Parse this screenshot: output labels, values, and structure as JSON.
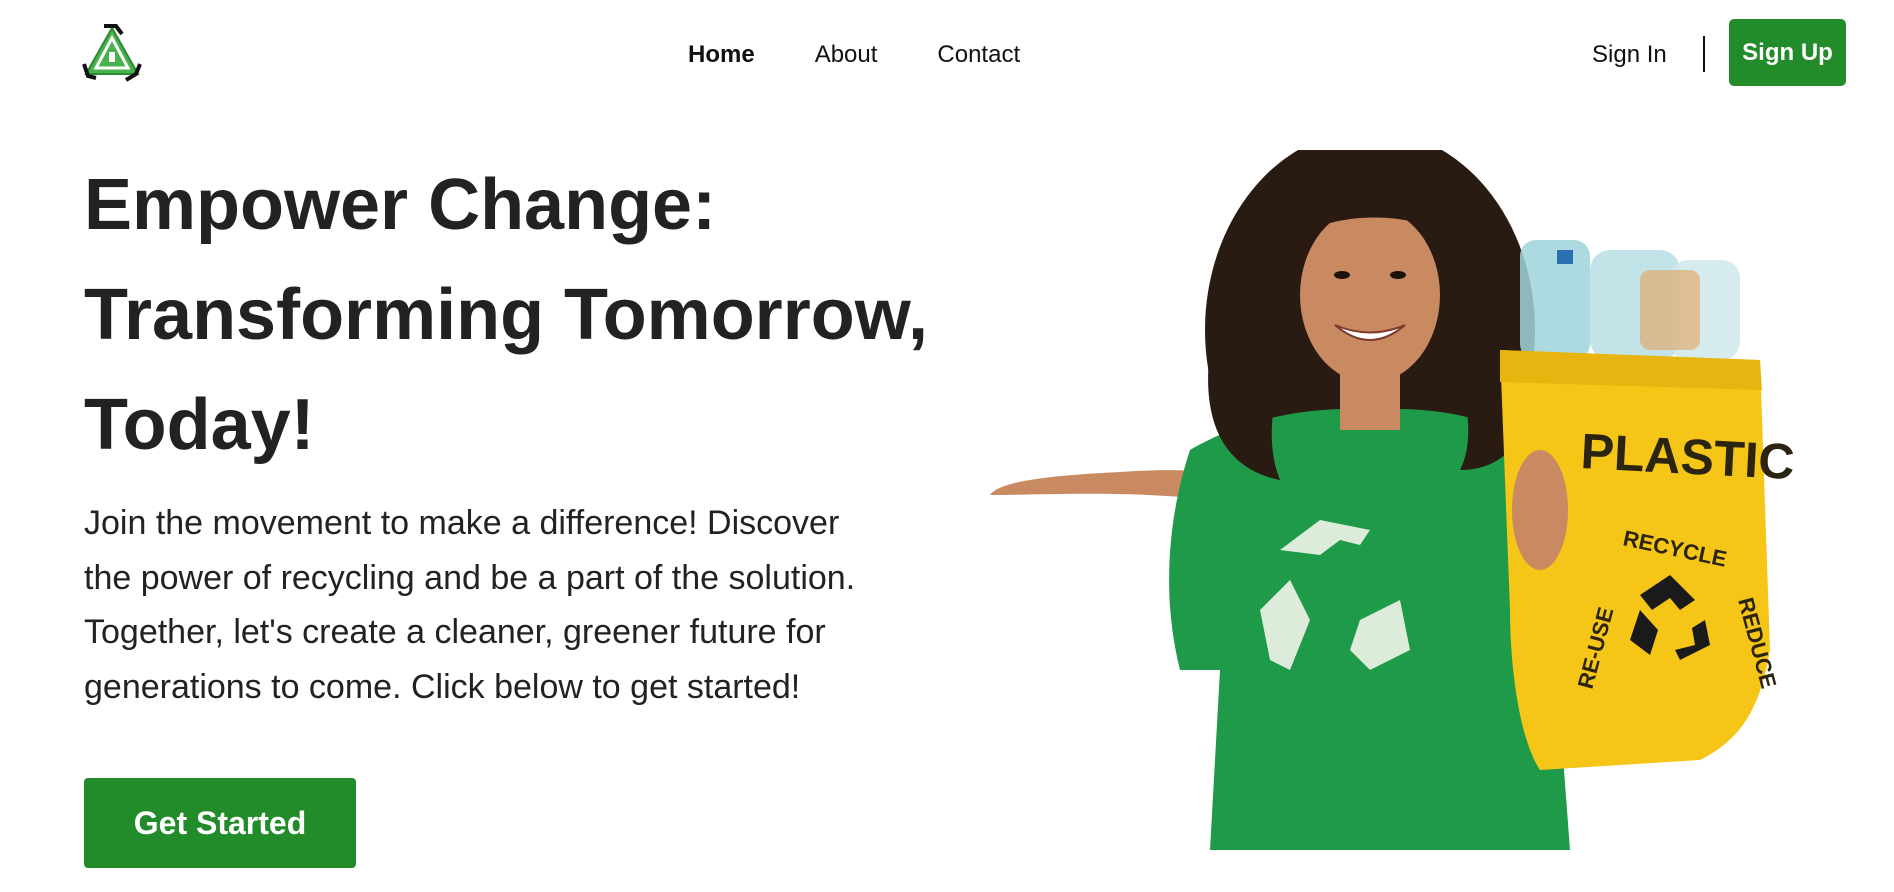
{
  "brand": {
    "logo_icon": "recycle-logo-icon",
    "accent_color": "#238c2a"
  },
  "nav": {
    "links": [
      {
        "label": "Home",
        "active": true
      },
      {
        "label": "About",
        "active": false
      },
      {
        "label": "Contact",
        "active": false
      }
    ],
    "sign_in_label": "Sign In",
    "sign_up_label": "Sign Up"
  },
  "hero": {
    "title_lines": [
      "Empower Change:",
      "Transforming Tomorrow,",
      "Today!"
    ],
    "description_lines": [
      "Join the movement to make a difference! Discover",
      "the power of recycling and be a part of the solution.",
      "Together, let's create a cleaner, greener future for",
      "generations to come. Click below to get started!"
    ],
    "cta_label": "Get Started"
  },
  "illustration": {
    "icon": "woman-holding-recycling-bag-illustration",
    "bag_text": "PLASTIC",
    "seal_words": [
      "RECYCLE",
      "RE-USE",
      "REDUCE"
    ]
  }
}
